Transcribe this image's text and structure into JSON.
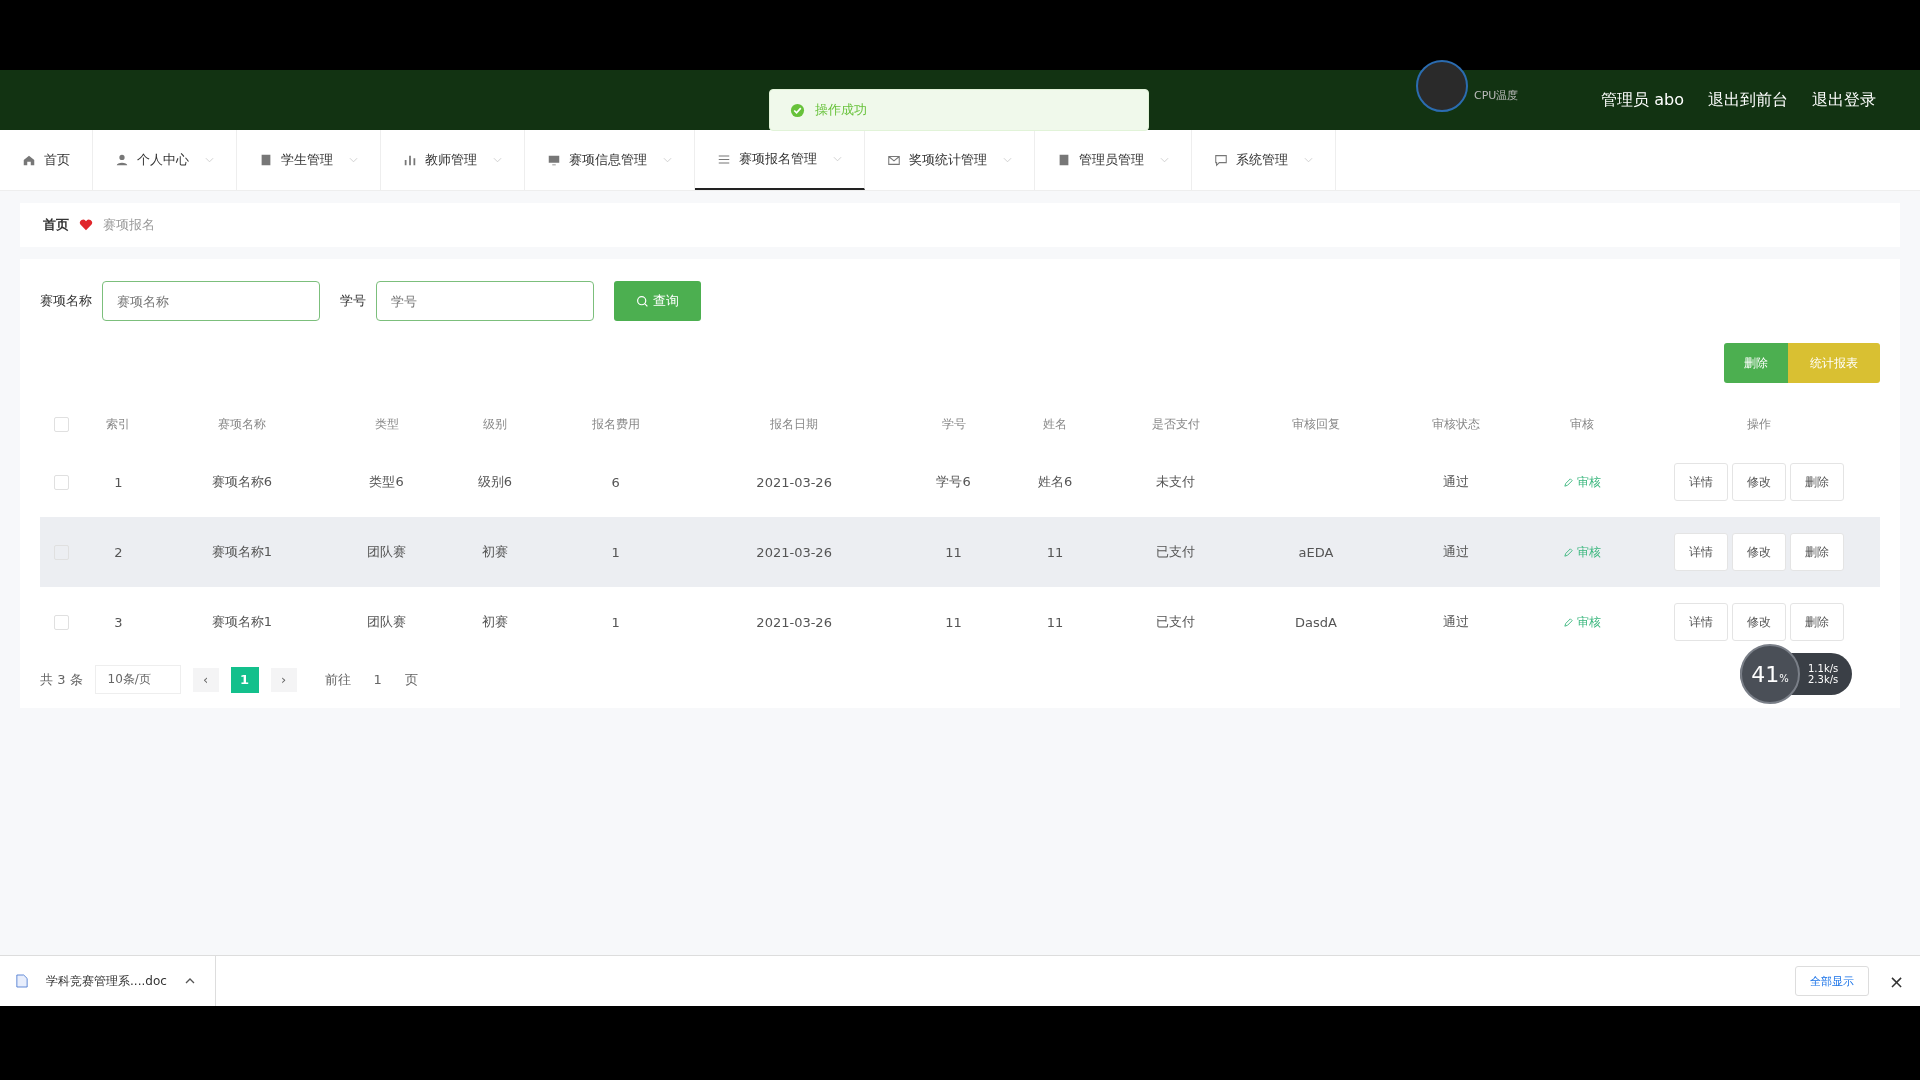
{
  "header": {
    "cpu_label": "CPU温度",
    "user": "管理员 abo",
    "links": [
      "退出到前台",
      "退出登录"
    ]
  },
  "toast": {
    "message": "操作成功"
  },
  "nav": [
    {
      "label": "首页",
      "kind": "home",
      "selected": false,
      "dropdown": false
    },
    {
      "label": "个人中心",
      "kind": "user",
      "selected": false,
      "dropdown": true
    },
    {
      "label": "学生管理",
      "kind": "book",
      "selected": false,
      "dropdown": true
    },
    {
      "label": "教师管理",
      "kind": "chart",
      "selected": false,
      "dropdown": true
    },
    {
      "label": "赛项信息管理",
      "kind": "monitor",
      "selected": false,
      "dropdown": true
    },
    {
      "label": "赛项报名管理",
      "kind": "list",
      "selected": true,
      "dropdown": true
    },
    {
      "label": "奖项统计管理",
      "kind": "mail",
      "selected": false,
      "dropdown": true
    },
    {
      "label": "管理员管理",
      "kind": "book",
      "selected": false,
      "dropdown": true
    },
    {
      "label": "系统管理",
      "kind": "chat",
      "selected": false,
      "dropdown": true
    }
  ],
  "breadcrumb": [
    "首页",
    "赛项报名"
  ],
  "search": {
    "fields": [
      {
        "label": "赛项名称",
        "placeholder": "赛项名称"
      },
      {
        "label": "学号",
        "placeholder": "学号"
      }
    ],
    "button": "查询"
  },
  "actions": [
    {
      "label": "删除",
      "kind": "delete"
    },
    {
      "label": "统计报表",
      "kind": "report"
    }
  ],
  "table": {
    "select_all_checked": false,
    "columns": [
      "索引",
      "赛项名称",
      "类型",
      "级别",
      "报名费用",
      "报名日期",
      "学号",
      "姓名",
      "是否支付",
      "审核回复",
      "审核状态",
      "审核",
      "操作"
    ],
    "rows": [
      {
        "checked": false,
        "highlighted": false,
        "cells": [
          "1",
          "赛项名称6",
          "类型6",
          "级别6",
          "6",
          "2021-03-26",
          "学号6",
          "姓名6",
          "未支付",
          "",
          "通过"
        ],
        "audit": "审核",
        "buttons": [
          "详情",
          "修改",
          "删除"
        ]
      },
      {
        "checked": false,
        "highlighted": true,
        "cells": [
          "2",
          "赛项名称1",
          "团队赛",
          "初赛",
          "1",
          "2021-03-26",
          "11",
          "11",
          "已支付",
          "aEDA",
          "通过"
        ],
        "audit": "审核",
        "buttons": [
          "详情",
          "修改",
          "删除"
        ]
      },
      {
        "checked": false,
        "highlighted": false,
        "cells": [
          "3",
          "赛项名称1",
          "团队赛",
          "初赛",
          "1",
          "2021-03-26",
          "11",
          "11",
          "已支付",
          "DasdA",
          "通过"
        ],
        "audit": "审核",
        "buttons": [
          "详情",
          "修改",
          "删除"
        ]
      }
    ]
  },
  "pagination": {
    "total": "共 3 条",
    "page_size": "10条/页",
    "prev": "‹",
    "next": "›",
    "pages": [
      {
        "label": "1",
        "selected": true
      }
    ],
    "goto_label": "前往",
    "goto_value": "1",
    "page_suffix": "页"
  },
  "net_widget": {
    "percent": "41",
    "unit": "%",
    "up": "1.1k/s",
    "down": "2.3k/s"
  },
  "download_bar": {
    "file": "学科竞赛管理系....doc",
    "show_all": "全部显示",
    "close": "×"
  }
}
